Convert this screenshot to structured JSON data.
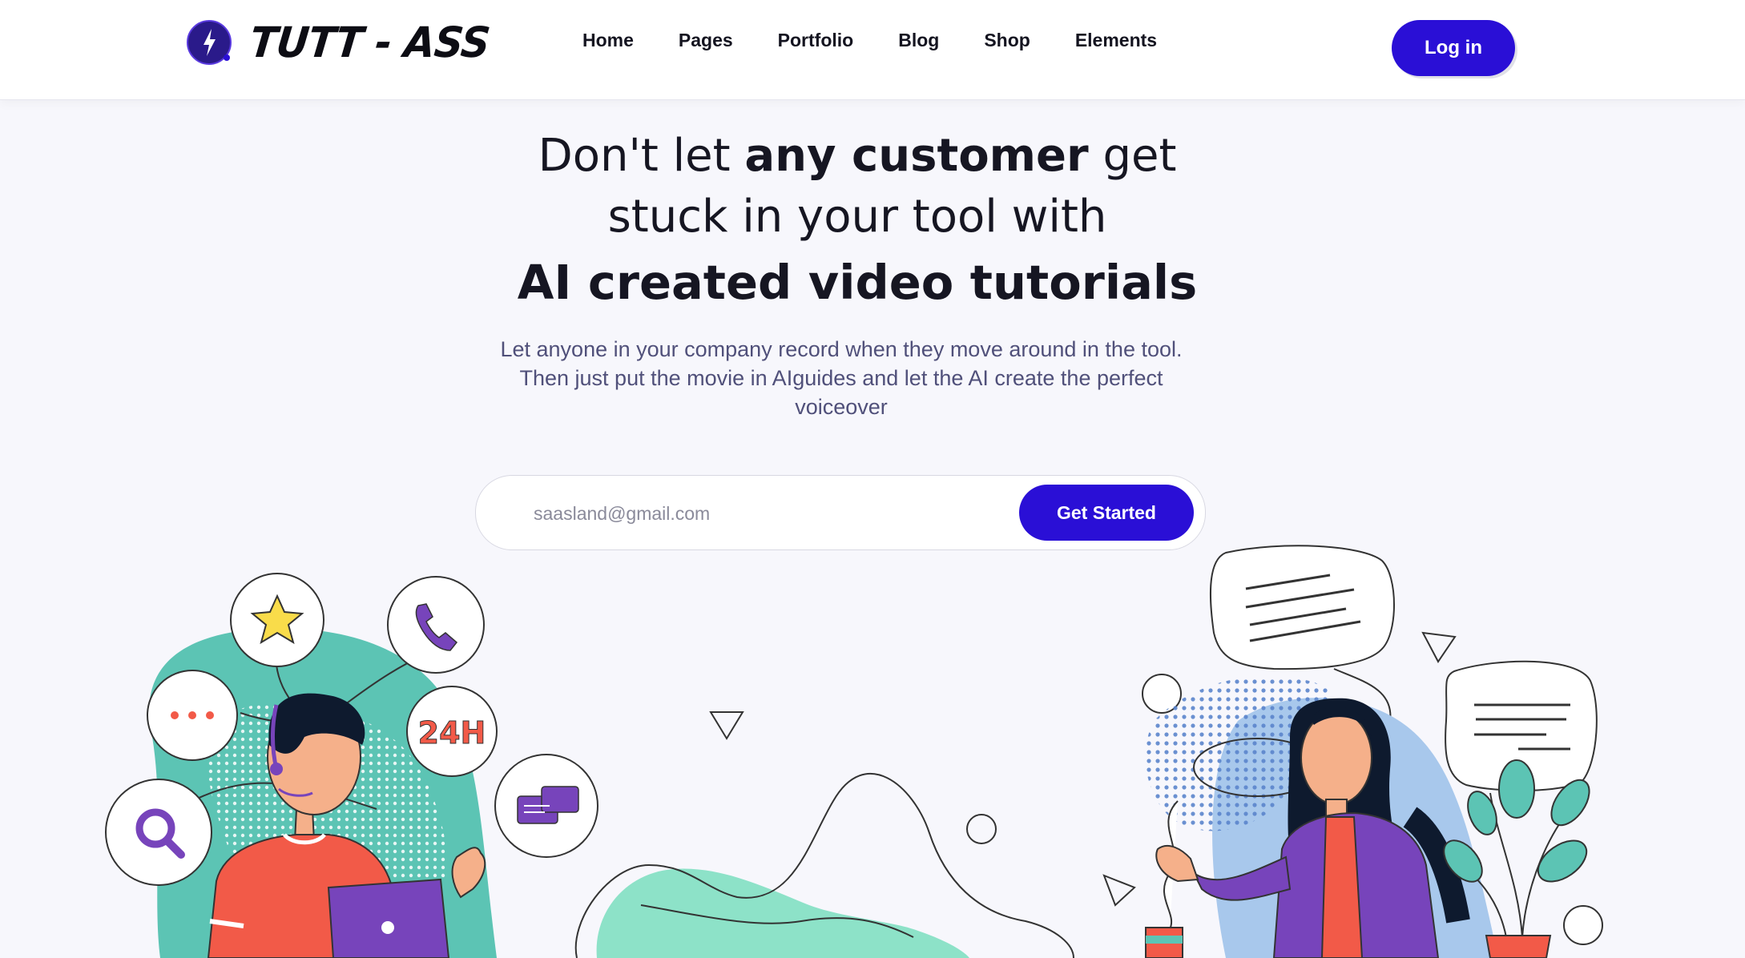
{
  "brand": {
    "name": "TUTT - ASS"
  },
  "nav": {
    "items": [
      "Home",
      "Pages",
      "Portfolio",
      "Blog",
      "Shop",
      "Elements"
    ],
    "login_label": "Log in"
  },
  "hero": {
    "line1_pre": "Don't let ",
    "line1_bold": "any customer",
    "line1_post": " get",
    "line2": "stuck in your tool with",
    "line3": "AI created video tutorials",
    "subtitle": "Let anyone in your company record when they move around in the tool. Then just put the movie in AIguides and let the AI create the perfect voiceover"
  },
  "signup": {
    "email_placeholder": "saasland@gmail.com",
    "button_label": "Get Started"
  },
  "support_bubbles": {
    "hours_label": "24H"
  },
  "colors": {
    "accent": "#2a0fd6",
    "teal": "#5cc4b4",
    "purple": "#7744bb",
    "coral": "#f25a48",
    "light_blue": "#a8c8ec"
  }
}
